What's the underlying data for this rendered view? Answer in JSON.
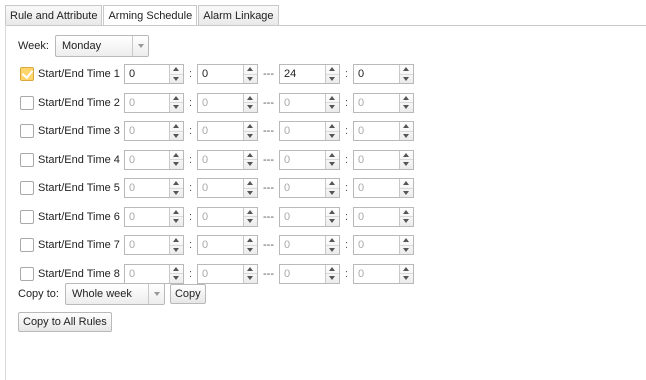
{
  "tabs": [
    {
      "label": "Rule and Attribute",
      "active": false
    },
    {
      "label": "Arming Schedule",
      "active": true
    },
    {
      "label": "Alarm Linkage",
      "active": false
    }
  ],
  "week": {
    "label": "Week:",
    "value": "Monday"
  },
  "rows": [
    {
      "label": "Start/End Time 1",
      "checked": true,
      "start_h": "0",
      "start_m": "0",
      "end_h": "24",
      "end_m": "0"
    },
    {
      "label": "Start/End Time 2",
      "checked": false,
      "start_h": "0",
      "start_m": "0",
      "end_h": "0",
      "end_m": "0"
    },
    {
      "label": "Start/End Time 3",
      "checked": false,
      "start_h": "0",
      "start_m": "0",
      "end_h": "0",
      "end_m": "0"
    },
    {
      "label": "Start/End Time 4",
      "checked": false,
      "start_h": "0",
      "start_m": "0",
      "end_h": "0",
      "end_m": "0"
    },
    {
      "label": "Start/End Time 5",
      "checked": false,
      "start_h": "0",
      "start_m": "0",
      "end_h": "0",
      "end_m": "0"
    },
    {
      "label": "Start/End Time 6",
      "checked": false,
      "start_h": "0",
      "start_m": "0",
      "end_h": "0",
      "end_m": "0"
    },
    {
      "label": "Start/End Time 7",
      "checked": false,
      "start_h": "0",
      "start_m": "0",
      "end_h": "0",
      "end_m": "0"
    },
    {
      "label": "Start/End Time 8",
      "checked": false,
      "start_h": "0",
      "start_m": "0",
      "end_h": "0",
      "end_m": "0"
    }
  ],
  "separators": {
    "colon": ":",
    "dash": "---"
  },
  "copy": {
    "label": "Copy to:",
    "value": "Whole week",
    "button": "Copy"
  },
  "copy_all": {
    "button": "Copy to All Rules"
  }
}
